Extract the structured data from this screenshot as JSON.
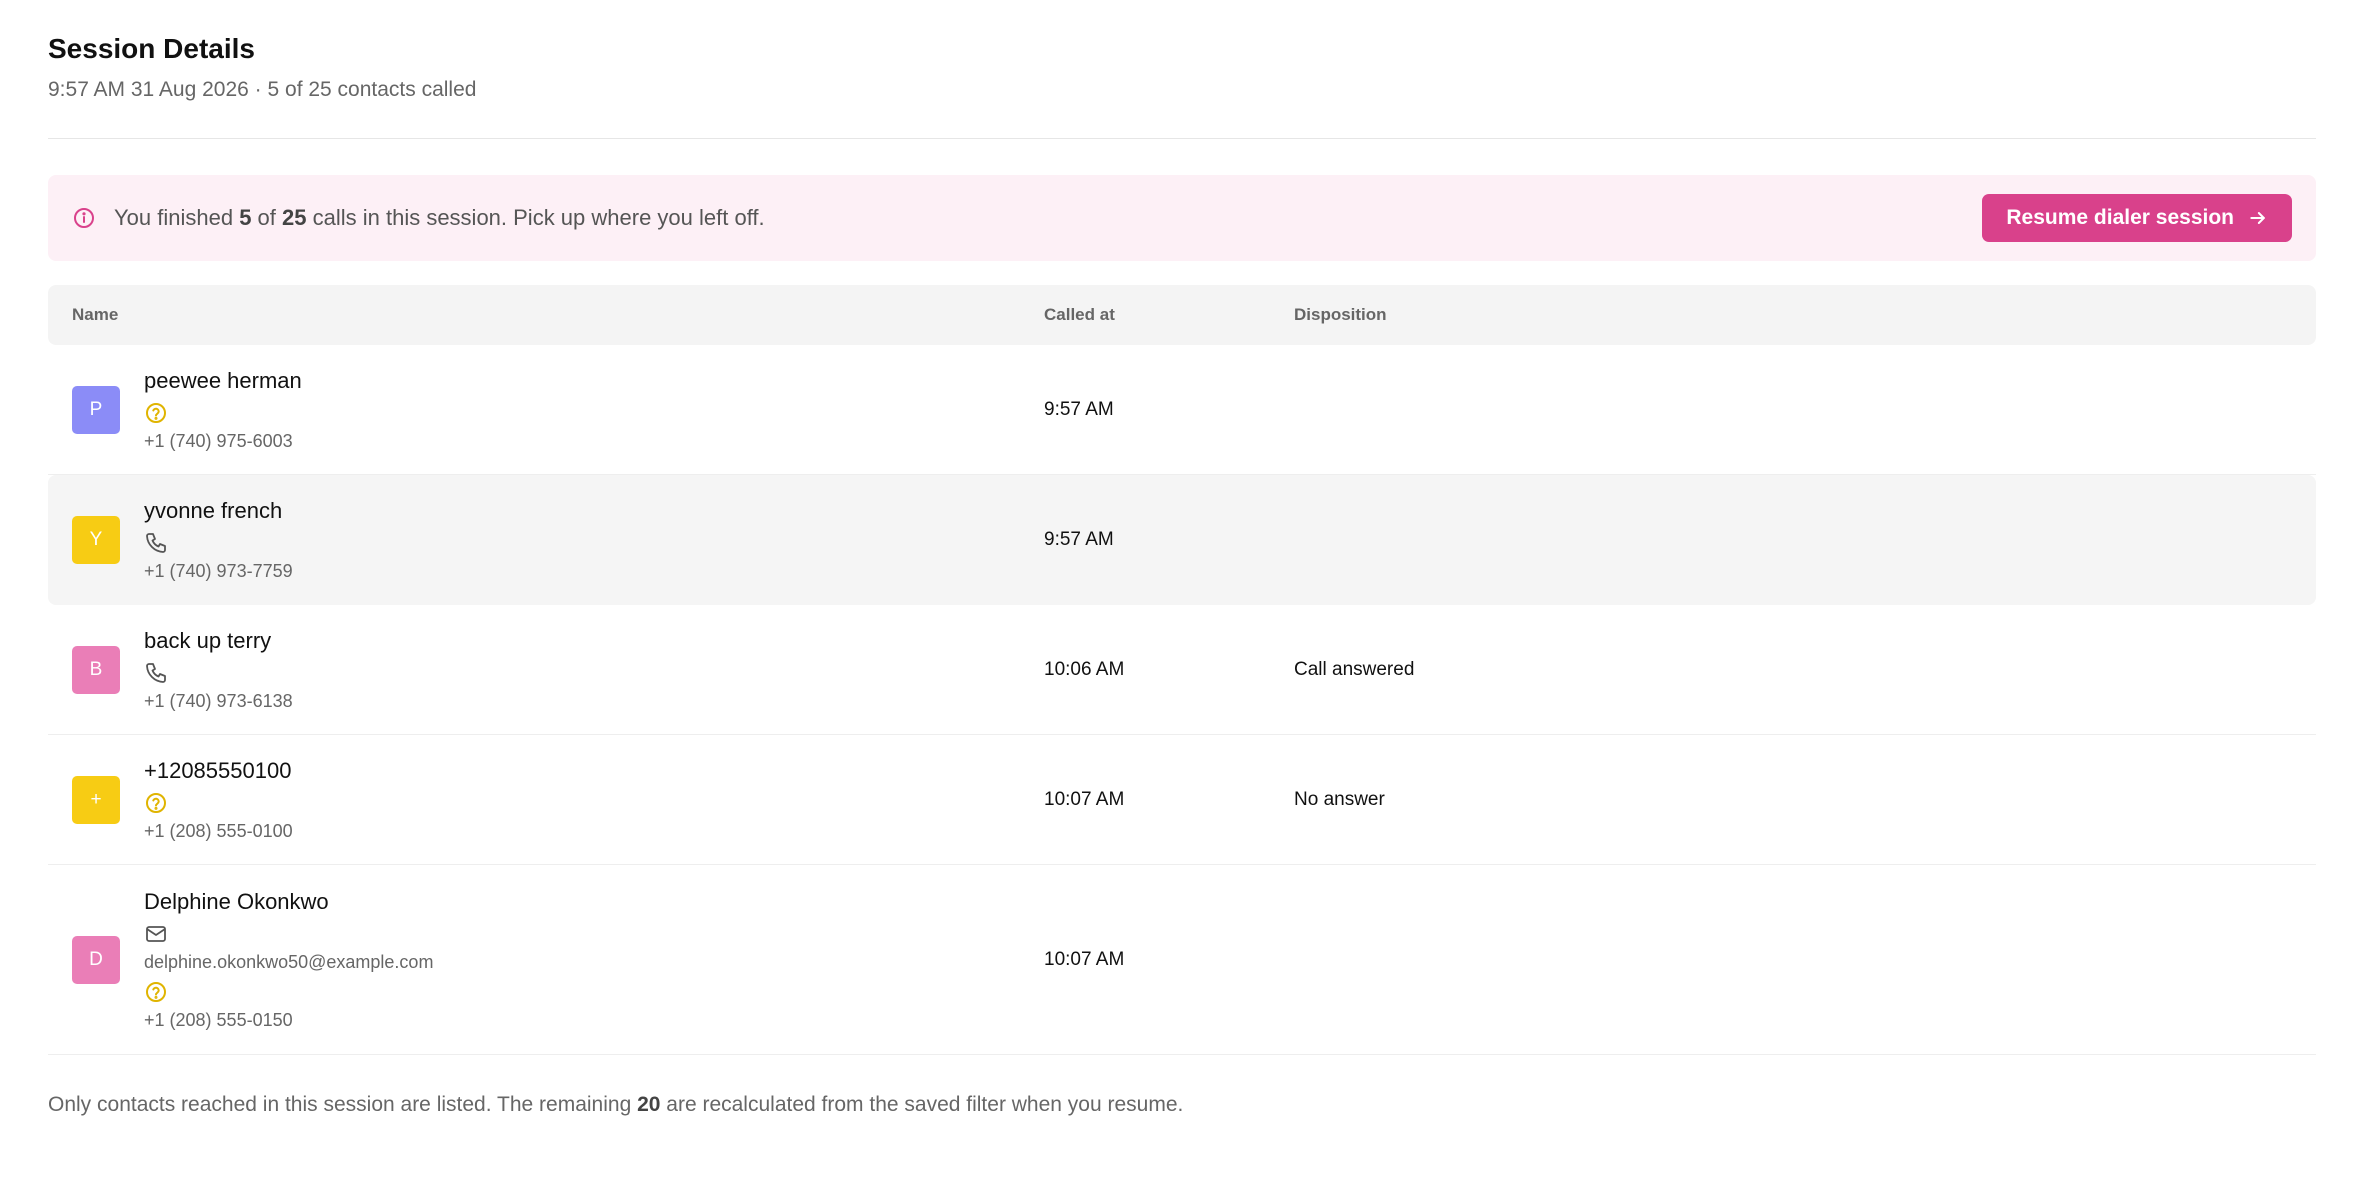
{
  "header": {
    "title": "Session Details",
    "subtitle": "9:57 AM 31 Aug 2026 · 5 of 25 contacts called"
  },
  "banner": {
    "text_before": "You finished ",
    "finished": "5",
    "text_of": " of ",
    "total": "25",
    "text_after": " calls in this session. Pick up where you left off.",
    "button_label": "Resume dialer session",
    "accent": "#d9418b",
    "background": "#fdf0f6"
  },
  "table": {
    "columns": {
      "name": "Name",
      "called_at": "Called at",
      "disposition": "Disposition"
    },
    "rows": [
      {
        "initial": "P",
        "avatar_color": "#8b8cf7",
        "name": "peewee herman",
        "icon": "question-circle-icon",
        "email": "",
        "phone": "+1 (740) 975-6003",
        "called_at": "9:57 AM",
        "disposition": ""
      },
      {
        "initial": "Y",
        "avatar_color": "#f7cc14",
        "name": "yvonne french",
        "icon": "phone-icon",
        "email": "",
        "phone": "+1 (740) 973-7759",
        "called_at": "9:57 AM",
        "disposition": ""
      },
      {
        "initial": "B",
        "avatar_color": "#ea7eb7",
        "name": "back up terry",
        "icon": "phone-icon",
        "email": "",
        "phone": "+1 (740) 973-6138",
        "called_at": "10:06 AM",
        "disposition": "Call answered"
      },
      {
        "initial": "+",
        "avatar_color": "#f7cc14",
        "name": "+12085550100",
        "icon": "question-circle-icon",
        "email": "",
        "phone": "+1 (208) 555-0100",
        "called_at": "10:07 AM",
        "disposition": "No answer"
      },
      {
        "initial": "D",
        "avatar_color": "#ea7eb7",
        "name": "Delphine Okonkwo",
        "icon": "mail-icon",
        "email": "delphine.okonkwo50@example.com",
        "phone": "+1 (208) 555-0150",
        "called_at": "10:07 AM",
        "disposition": ""
      }
    ]
  },
  "footnote": {
    "before": "Only contacts reached in this session are listed. The remaining ",
    "remaining": "20",
    "after": " are recalculated from the saved filter when you resume."
  }
}
